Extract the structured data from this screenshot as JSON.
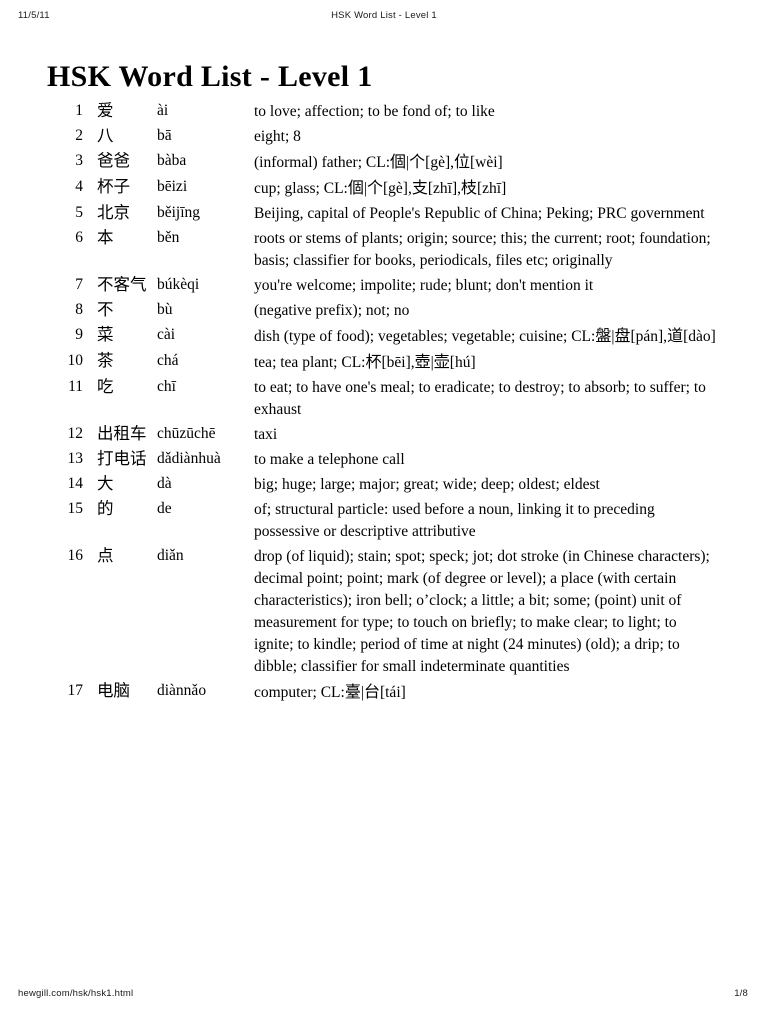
{
  "print_header": {
    "date": "11/5/11",
    "doc_title": "HSK Word List - Level 1"
  },
  "page_title": "HSK Word List - Level 1",
  "print_footer": {
    "url": "hewgill.com/hsk/hsk1.html",
    "page_number": "1/8"
  },
  "entries": [
    {
      "num": "1",
      "hanzi": "爱",
      "pinyin": "ài",
      "definition": "to love; affection; to be fond of; to like"
    },
    {
      "num": "2",
      "hanzi": "八",
      "pinyin": "bā",
      "definition": "eight; 8"
    },
    {
      "num": "3",
      "hanzi": "爸爸",
      "pinyin": "bàba",
      "definition": "(informal) father; CL:個|个[gè],位[wèi]"
    },
    {
      "num": "4",
      "hanzi": "杯子",
      "pinyin": "bēizi",
      "definition": "cup; glass; CL:個|个[gè],支[zhī],枝[zhī]"
    },
    {
      "num": "5",
      "hanzi": "北京",
      "pinyin": "běijīng",
      "definition": "Beijing, capital of People's Republic of China; Peking; PRC government"
    },
    {
      "num": "6",
      "hanzi": "本",
      "pinyin": "běn",
      "definition": "roots or stems of plants; origin; source; this; the current; root; foundation; basis; classifier for books, periodicals, files etc; originally"
    },
    {
      "num": "7",
      "hanzi": "不客气",
      "pinyin": "búkèqi",
      "definition": "you're welcome; impolite; rude; blunt; don't mention it"
    },
    {
      "num": "8",
      "hanzi": "不",
      "pinyin": "bù",
      "definition": "(negative prefix); not; no"
    },
    {
      "num": "9",
      "hanzi": "菜",
      "pinyin": "cài",
      "definition": "dish (type of food); vegetables; vegetable; cuisine; CL:盤|盘[pán],道[dào]"
    },
    {
      "num": "10",
      "hanzi": "茶",
      "pinyin": "chá",
      "definition": "tea; tea plant; CL:杯[bēi],壺|壶[hú]"
    },
    {
      "num": "11",
      "hanzi": "吃",
      "pinyin": "chī",
      "definition": "to eat; to have one's meal; to eradicate; to destroy; to absorb; to suffer; to exhaust"
    },
    {
      "num": "12",
      "hanzi": "出租车",
      "pinyin": "chūzūchē",
      "definition": "taxi"
    },
    {
      "num": "13",
      "hanzi": "打电话",
      "pinyin": "dǎdiànhuà",
      "definition": "to make a telephone call"
    },
    {
      "num": "14",
      "hanzi": "大",
      "pinyin": "dà",
      "definition": "big; huge; large; major; great; wide; deep; oldest; eldest"
    },
    {
      "num": "15",
      "hanzi": "的",
      "pinyin": "de",
      "definition": "of; structural particle: used before a noun, linking it to preceding possessive or descriptive attributive"
    },
    {
      "num": "16",
      "hanzi": "点",
      "pinyin": "diǎn",
      "definition": "drop (of liquid); stain; spot; speck; jot; dot stroke (in Chinese characters); decimal point; point; mark (of degree or level); a place (with certain characteristics); iron bell; o’clock; a little; a bit; some; (point) unit of measurement for type; to touch on briefly; to make clear; to light; to ignite; to kindle; period of time at night (24 minutes) (old); a drip; to dibble; classifier for small indeterminate quantities"
    },
    {
      "num": "17",
      "hanzi": "电脑",
      "pinyin": "diànnǎo",
      "definition": "computer; CL:臺|台[tái]"
    }
  ]
}
